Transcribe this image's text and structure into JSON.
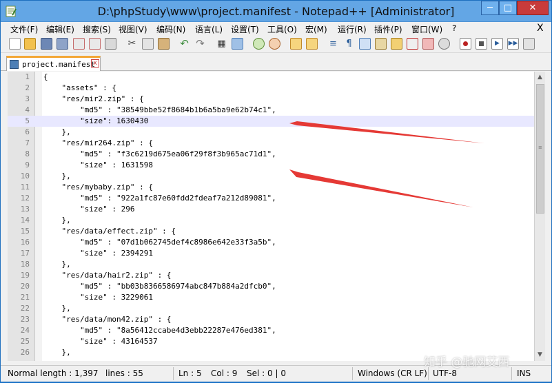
{
  "window": {
    "title": "D:\\phpStudy\\www\\project.manifest - Notepad++ [Administrator]",
    "min_label": "─",
    "max_label": "□",
    "close_label": "✕"
  },
  "menu": {
    "items": [
      "文件(F)",
      "编辑(E)",
      "搜索(S)",
      "视图(V)",
      "编码(N)",
      "语言(L)",
      "设置(T)",
      "工具(O)",
      "宏(M)",
      "运行(R)",
      "插件(P)",
      "窗口(W)",
      "?"
    ],
    "close": "X"
  },
  "toolbar": {
    "icons": [
      "new-icon",
      "open-icon",
      "save-icon",
      "save-all-icon",
      "close-icon",
      "close-all-icon",
      "print-icon",
      "cut-icon",
      "copy-icon",
      "paste-icon",
      "undo-icon",
      "redo-icon",
      "find-icon",
      "replace-icon",
      "zoom-in-icon",
      "zoom-out-icon",
      "sync-v-icon",
      "sync-h-icon",
      "word-wrap-icon",
      "show-all-icon",
      "indent-guide-icon",
      "udl-icon",
      "doc-map-icon",
      "function-list-icon",
      "folder-icon",
      "monitor-icon",
      "record-icon",
      "stop-icon",
      "play-icon",
      "run-multiple-icon",
      "save-macro-icon"
    ]
  },
  "tab": {
    "label": "project.manifest",
    "close": "x"
  },
  "editor": {
    "current_line": 5,
    "lines": [
      {
        "n": "1",
        "text": "{"
      },
      {
        "n": "2",
        "text": "    \"assets\" : {"
      },
      {
        "n": "3",
        "text": "    \"res/mir2.zip\" : {"
      },
      {
        "n": "4",
        "text": "        \"md5\" : \"38549bbe52f8684b1b6a5ba9e62b74c1\","
      },
      {
        "n": "5",
        "text": "        \"size\": 1630430"
      },
      {
        "n": "6",
        "text": "    },"
      },
      {
        "n": "7",
        "text": "    \"res/mir264.zip\" : {"
      },
      {
        "n": "8",
        "text": "        \"md5\" : \"f3c6219d675ea06f29f8f3b965ac71d1\","
      },
      {
        "n": "9",
        "text": "        \"size\" : 1631598"
      },
      {
        "n": "10",
        "text": "    },"
      },
      {
        "n": "11",
        "text": "    \"res/mybaby.zip\" : {"
      },
      {
        "n": "12",
        "text": "        \"md5\" : \"922a1fc87e60fdd2fdeaf7a212d89081\","
      },
      {
        "n": "13",
        "text": "        \"size\" : 296"
      },
      {
        "n": "14",
        "text": "    },"
      },
      {
        "n": "15",
        "text": "    \"res/data/effect.zip\" : {"
      },
      {
        "n": "16",
        "text": "        \"md5\" : \"07d1b062745def4c8986e642e33f3a5b\","
      },
      {
        "n": "17",
        "text": "        \"size\" : 2394291"
      },
      {
        "n": "18",
        "text": "    },"
      },
      {
        "n": "19",
        "text": "    \"res/data/hair2.zip\" : {"
      },
      {
        "n": "20",
        "text": "        \"md5\" : \"bb03b8366586974abc847b884a2dfcb0\","
      },
      {
        "n": "21",
        "text": "        \"size\" : 3229061"
      },
      {
        "n": "22",
        "text": "    },"
      },
      {
        "n": "23",
        "text": "    \"res/data/mon42.zip\" : {"
      },
      {
        "n": "24",
        "text": "        \"md5\" : \"8a56412ccabe4d3ebb22287e476ed381\","
      },
      {
        "n": "25",
        "text": "        \"size\" : 43164537"
      },
      {
        "n": "26",
        "text": "    },"
      }
    ]
  },
  "annotations": {
    "arrow_color": "#e53935"
  },
  "status": {
    "length": "Normal length : 1,397",
    "lines": "lines : 55",
    "ln": "Ln : 5",
    "col": "Col : 9",
    "sel": "Sel : 0 | 0",
    "eol": "Windows (CR LF)",
    "encoding": "UTF-8",
    "mode": "INS"
  },
  "watermark": "知乎 @驰网艾西"
}
